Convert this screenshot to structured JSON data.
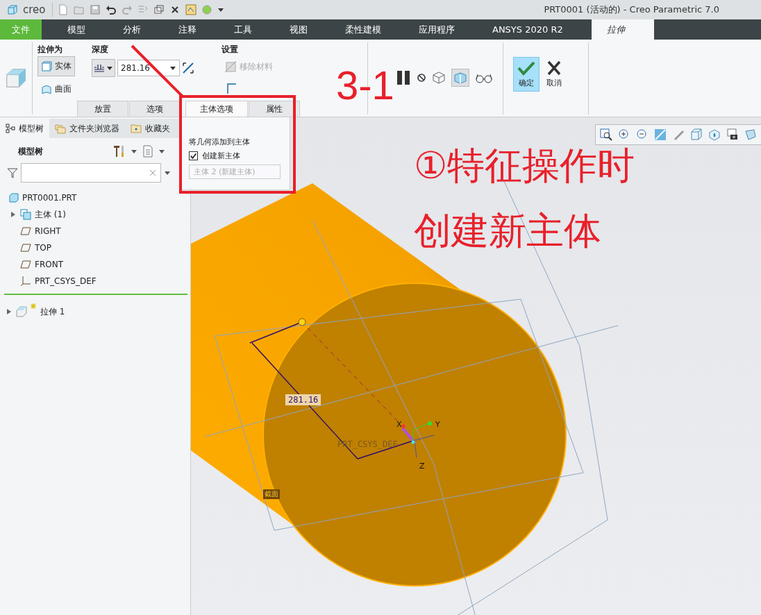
{
  "title_bar": {
    "app_name": "creo",
    "title": "PRT0001 (活动的) - Creo Parametric 7.0"
  },
  "ribbon_tabs": [
    {
      "label": "文件",
      "kind": "file",
      "selected": false
    },
    {
      "label": "模型",
      "kind": "tab",
      "selected": false
    },
    {
      "label": "分析",
      "kind": "tab",
      "selected": false
    },
    {
      "label": "注释",
      "kind": "tab",
      "selected": false
    },
    {
      "label": "工具",
      "kind": "tab",
      "selected": false
    },
    {
      "label": "视图",
      "kind": "tab",
      "selected": false
    },
    {
      "label": "柔性建模",
      "kind": "tab",
      "selected": false
    },
    {
      "label": "应用程序",
      "kind": "tab",
      "selected": false
    },
    {
      "label": "ANSYS 2020 R2",
      "kind": "tab",
      "selected": false
    },
    {
      "label": "拉伸",
      "kind": "context",
      "selected": true
    }
  ],
  "ribbon": {
    "extrude_as": {
      "label": "拉伸为",
      "options": [
        {
          "label": "实体",
          "selected": true
        },
        {
          "label": "曲面",
          "selected": false
        }
      ]
    },
    "depth": {
      "label": "深度",
      "value": "281.16"
    },
    "settings": {
      "label": "设置",
      "remove_material": {
        "label": "移除材料",
        "disabled": true
      }
    },
    "actions": [
      {
        "label": "确定",
        "kind": "ok",
        "selected": true
      },
      {
        "label": "取消",
        "kind": "cancel",
        "selected": false
      }
    ]
  },
  "sub_tabs": [
    {
      "label": "放置",
      "selected": false
    },
    {
      "label": "选项",
      "selected": false
    },
    {
      "label": "主体选项",
      "selected": true
    },
    {
      "label": "属性",
      "selected": false
    }
  ],
  "body_options_panel": {
    "heading": "将几何添加到主体",
    "create_new_body": {
      "label": "创建新主体",
      "checked": true
    },
    "body_field": {
      "value": "主体 2 (新建主体)",
      "disabled": true
    }
  },
  "navigator_tabs": [
    {
      "label": "模型树",
      "selected": true
    },
    {
      "label": "文件夹浏览器",
      "selected": false
    },
    {
      "label": "收藏夹",
      "selected": false
    }
  ],
  "model_tree": {
    "title": "模型树",
    "items": [
      {
        "label": "PRT0001.PRT",
        "kind": "part",
        "collapsed": false,
        "children": [
          {
            "label": "主体 (1)",
            "kind": "bodies",
            "collapsed": true
          },
          {
            "label": "RIGHT",
            "kind": "plane",
            "collapsed": false
          },
          {
            "label": "TOP",
            "kind": "plane",
            "collapsed": false
          },
          {
            "label": "FRONT",
            "kind": "plane",
            "collapsed": false
          },
          {
            "label": "PRT_CSYS_DEF",
            "kind": "csys",
            "collapsed": false
          }
        ]
      }
    ],
    "insert_items": [
      {
        "label": "拉伸 1",
        "kind": "feature",
        "collapsed": true,
        "new": true
      }
    ]
  },
  "viewport": {
    "dimension": "281.16",
    "csys_label": "PRT_CSYS_DEF",
    "axes": [
      "X",
      "Y",
      "Z"
    ],
    "section_label": "截面"
  },
  "annotations": {
    "step": "3-1",
    "note_lines": [
      "①特征操作时",
      "创建新主体"
    ]
  }
}
